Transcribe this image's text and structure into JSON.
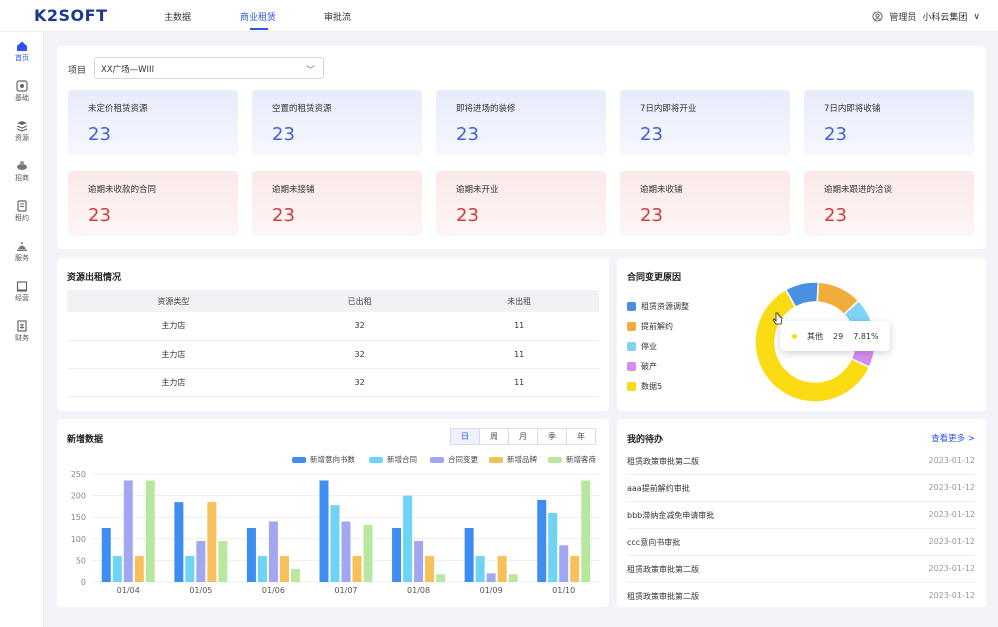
{
  "header": {
    "logo": "K2SOFT",
    "nav": [
      "主数据",
      "商业租赁",
      "审批流"
    ],
    "active_nav": 1,
    "user_role": "管理员",
    "org": "小科云集团",
    "org_chevron": "∨"
  },
  "sidebar": [
    {
      "label": "首页",
      "icon": "home-icon",
      "active": true
    },
    {
      "label": "基础",
      "icon": "base-icon"
    },
    {
      "label": "资源",
      "icon": "layers-icon"
    },
    {
      "label": "招商",
      "icon": "investment-icon"
    },
    {
      "label": "租约",
      "icon": "lease-icon"
    },
    {
      "label": "服务",
      "icon": "service-icon"
    },
    {
      "label": "经营",
      "icon": "operation-icon"
    },
    {
      "label": "财务",
      "icon": "finance-icon"
    }
  ],
  "project": {
    "label": "项目",
    "value": "XX广场—WIII"
  },
  "stats_blue": [
    {
      "title": "未定价租赁资源",
      "value": "23"
    },
    {
      "title": "空置的租赁资源",
      "value": "23"
    },
    {
      "title": "即将进场的装修",
      "value": "23"
    },
    {
      "title": "7日内即将开业",
      "value": "23"
    },
    {
      "title": "7日内即将收铺",
      "value": "23"
    }
  ],
  "stats_red": [
    {
      "title": "逾期未收款的合同",
      "value": "23"
    },
    {
      "title": "逾期未接铺",
      "value": "23"
    },
    {
      "title": "逾期未开业",
      "value": "23"
    },
    {
      "title": "逾期未收铺",
      "value": "23"
    },
    {
      "title": "逾期未跟进的洽谈",
      "value": "23"
    }
  ],
  "rent_table": {
    "title": "资源出租情况",
    "headers": [
      "资源类型",
      "已出租",
      "未出租"
    ],
    "rows": [
      [
        "主力店",
        "32",
        "11"
      ],
      [
        "主力店",
        "32",
        "11"
      ],
      [
        "主力店",
        "32",
        "11"
      ]
    ]
  },
  "contract_change": {
    "title": "合同变更原因",
    "legend": [
      {
        "name": "租赁资源调整",
        "color": "#4a90e2"
      },
      {
        "name": "提前解约",
        "color": "#f0ad3c"
      },
      {
        "name": "停业",
        "color": "#7fd3f3"
      },
      {
        "name": "破产",
        "color": "#d48cf0"
      },
      {
        "name": "数据5",
        "color": "#fadb14"
      }
    ],
    "tooltip": {
      "name": "其他",
      "count": "29",
      "pct": "7.81%"
    }
  },
  "new_data": {
    "title": "新增数据",
    "periods": [
      "日",
      "周",
      "月",
      "季",
      "年"
    ],
    "active_period": 0
  },
  "todo": {
    "title": "我的待办",
    "more": "查看更多 >",
    "items": [
      {
        "name": "租赁政策审批第二版",
        "date": "2023-01-12"
      },
      {
        "name": "aaa提前解约审批",
        "date": "2023-01-12"
      },
      {
        "name": "bbb滞纳金减免申请审批",
        "date": "2023-01-12"
      },
      {
        "name": "ccc意向书审批",
        "date": "2023-01-12"
      },
      {
        "name": "租赁政策审批第二版",
        "date": "2023-01-12"
      },
      {
        "name": "租赁政策审批第二版",
        "date": "2023-01-12"
      }
    ]
  },
  "chart_data": [
    {
      "type": "bar",
      "categories": [
        "01/04",
        "01/05",
        "01/06",
        "01/07",
        "01/08",
        "01/09",
        "01/10"
      ],
      "ylim": [
        0,
        250
      ],
      "yticks": [
        0,
        50,
        100,
        150,
        200,
        250
      ],
      "grid": true,
      "legend_position": "top-right",
      "series": [
        {
          "name": "新增意向书数",
          "color": "#3d8ef0",
          "values": [
            125,
            185,
            125,
            235,
            125,
            125,
            190
          ]
        },
        {
          "name": "新增合同",
          "color": "#6ed4f5",
          "values": [
            60,
            60,
            60,
            178,
            200,
            60,
            160
          ]
        },
        {
          "name": "合同变更",
          "color": "#a1a7f0",
          "values": [
            235,
            95,
            140,
            140,
            95,
            20,
            85
          ]
        },
        {
          "name": "新增品牌",
          "color": "#f6c05a",
          "values": [
            60,
            185,
            60,
            60,
            60,
            60,
            60
          ]
        },
        {
          "name": "新增客商",
          "color": "#b8e8a0",
          "values": [
            235,
            95,
            30,
            132,
            18,
            18,
            235
          ]
        }
      ]
    },
    {
      "type": "pie",
      "title": "合同变更原因",
      "donut": true,
      "labels": [
        "租赁资源调整",
        "提前解约",
        "停业",
        "破产",
        "数据5"
      ],
      "values": [
        9,
        12,
        8,
        11,
        60
      ],
      "colors": [
        "#4a90e2",
        "#f0ad3c",
        "#7fd3f3",
        "#d48cf0",
        "#fadb14"
      ]
    }
  ]
}
